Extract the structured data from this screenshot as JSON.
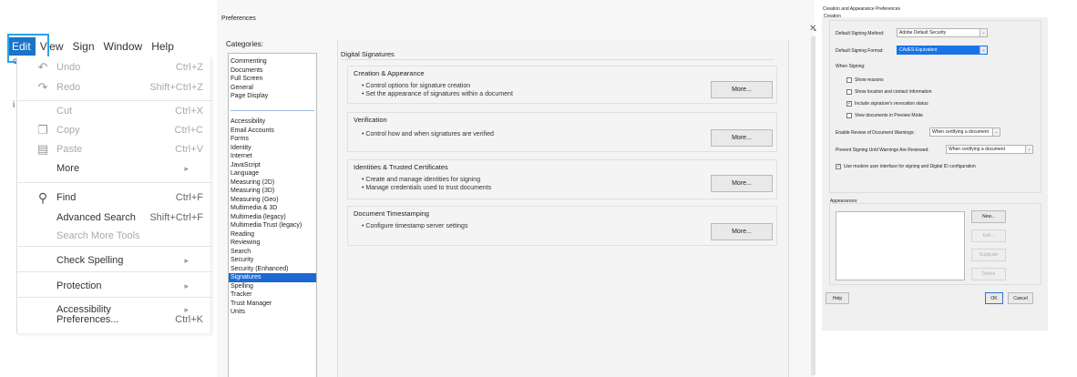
{
  "edit_menu": {
    "menubar": [
      "Edit",
      "View",
      "Sign",
      "Window",
      "Help"
    ],
    "items": [
      {
        "label": "Undo",
        "shortcut": "Ctrl+Z",
        "icon": "undo-icon",
        "disabled": true
      },
      {
        "label": "Redo",
        "shortcut": "Shift+Ctrl+Z",
        "icon": "redo-icon",
        "disabled": true
      },
      {
        "label": "Cut",
        "shortcut": "Ctrl+X",
        "disabled": true
      },
      {
        "label": "Copy",
        "shortcut": "Ctrl+C",
        "icon": "copy-icon",
        "disabled": true
      },
      {
        "label": "Paste",
        "shortcut": "Ctrl+V",
        "icon": "paste-icon",
        "disabled": true
      },
      {
        "label": "More",
        "submenu": true
      },
      {
        "label": "Find",
        "shortcut": "Ctrl+F",
        "icon": "search-icon"
      },
      {
        "label": "Advanced Search",
        "shortcut": "Shift+Ctrl+F"
      },
      {
        "label": "Search More Tools",
        "disabled": true
      },
      {
        "label": "Check Spelling",
        "submenu": true
      },
      {
        "label": "Protection",
        "submenu": true
      },
      {
        "label": "Accessibility",
        "submenu": true
      },
      {
        "label": "Preferences...",
        "shortcut": "Ctrl+K"
      }
    ],
    "highlight_color": "#2aa3e6",
    "active_color": "#1a73c8"
  },
  "preferences": {
    "title": "Preferences",
    "categories_label": "Categories:",
    "top_categories": [
      "Commenting",
      "Documents",
      "Full Screen",
      "General",
      "Page Display"
    ],
    "categories": [
      "Accessibility",
      "Email Accounts",
      "Forms",
      "Identity",
      "Internet",
      "JavaScript",
      "Language",
      "Measuring (2D)",
      "Measuring (3D)",
      "Measuring (Geo)",
      "Multimedia & 3D",
      "Multimedia (legacy)",
      "Multimedia Trust (legacy)",
      "Reading",
      "Reviewing",
      "Search",
      "Security",
      "Security (Enhanced)",
      "Signatures",
      "Spelling",
      "Tracker",
      "Trust Manager",
      "Units"
    ],
    "selected_category": "Signatures",
    "section_title": "Digital Signatures",
    "groups": [
      {
        "title": "Creation & Appearance",
        "bullets": [
          "• Control options for signature creation",
          "• Set the appearance of signatures within a document"
        ],
        "button": "More..."
      },
      {
        "title": "Verification",
        "bullets": [
          "• Control how and when signatures are verified"
        ],
        "button": "More..."
      },
      {
        "title": "Identities & Trusted Certificates",
        "bullets": [
          "• Create and manage identities for signing",
          "• Manage credentials used to trust documents"
        ],
        "button": "More..."
      },
      {
        "title": "Document Timestamping",
        "bullets": [
          "• Configure timestamp server settings"
        ],
        "button": "More..."
      }
    ]
  },
  "creation_prefs": {
    "title": "Creation and Appearance Preferences",
    "creation_label": "Creation",
    "default_method_label": "Default Signing Method:",
    "default_method_value": "Adobe Default Security",
    "default_format_label": "Default Signing Format:",
    "default_format_value": "CAdES-Equivalent",
    "when_signing_label": "When Signing:",
    "checkboxes": [
      {
        "label": "Show reasons",
        "checked": false
      },
      {
        "label": "Show location and contact information",
        "checked": false
      },
      {
        "label": "Include signature's revocation status",
        "checked": true
      },
      {
        "label": "View documents in Preview Mode",
        "checked": false
      }
    ],
    "enable_review_label": "Enable Review of Document Warnings:",
    "enable_review_value": "When certifying a document",
    "prevent_signing_label": "Prevent Signing Until Warnings Are Reviewed:",
    "prevent_signing_value": "When certifying a document",
    "modern_ui_label": "Use modern user interface for signing and Digital ID configuration",
    "modern_ui_checked": true,
    "appearances_label": "Appearances",
    "buttons": {
      "new": "New...",
      "edit": "Edit...",
      "duplicate": "Duplicate",
      "delete": "Delete"
    },
    "help": "Help",
    "ok": "OK",
    "cancel": "Cancel"
  }
}
